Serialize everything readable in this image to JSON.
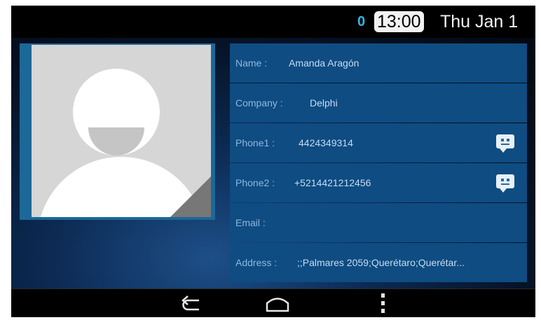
{
  "status_bar": {
    "notification": "0",
    "time": "13:00",
    "date": "Thu Jan 1"
  },
  "contact": {
    "photo_icon": "default-avatar-icon",
    "fields": [
      {
        "label": "Name :",
        "value": "Amanda Aragón"
      },
      {
        "label": "Company :",
        "value": "Delphi"
      },
      {
        "label": "Phone1 :",
        "value": "4424349314",
        "action_icon": "message-icon"
      },
      {
        "label": "Phone2 :",
        "value": "+5214421212456",
        "action_icon": "message-icon"
      },
      {
        "label": "Email :",
        "value": ""
      },
      {
        "label": "Address :",
        "value": ";;Palmares 2059;Querétaro;Querétar..."
      }
    ]
  },
  "nav_bar": {
    "buttons": [
      "back-icon",
      "home-icon",
      "menu-icon"
    ]
  },
  "colors": {
    "accent": "#33b5e5",
    "row_background": "#0e4c82",
    "photo_frame": "#1c6898"
  }
}
